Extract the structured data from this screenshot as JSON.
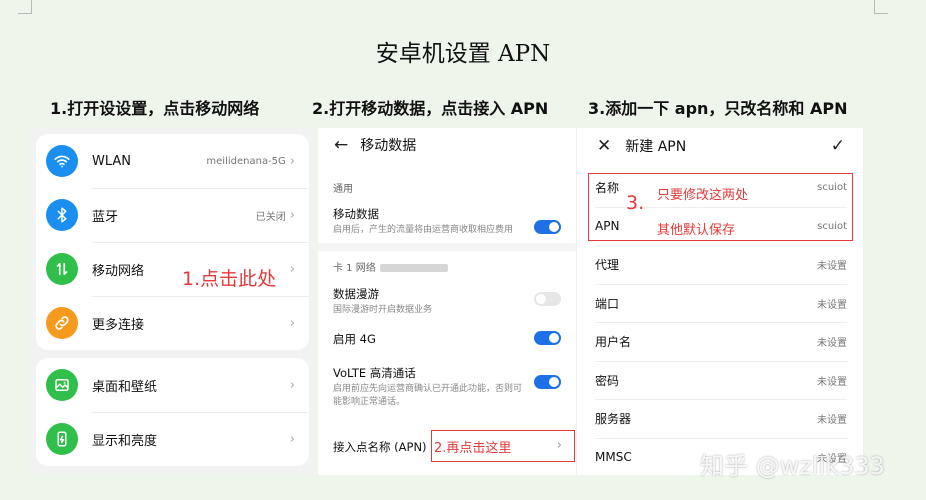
{
  "title": "安卓机设置 APN",
  "steps": [
    "1.打开设设置，点击移动网络",
    "2.打开移动数据，点击接入 APN",
    "3.添加一下 apn，只改名称和 APN"
  ],
  "settings": {
    "items": [
      {
        "label": "WLAN",
        "value": "meilidenana-5G",
        "icon": "wifi-icon",
        "color": "#1b8ff0"
      },
      {
        "label": "蓝牙",
        "value": "已关闭",
        "icon": "bluetooth-icon",
        "color": "#1b8ff0"
      },
      {
        "label": "移动网络",
        "value": "",
        "icon": "mobile-network-icon",
        "color": "#2fbf4a"
      },
      {
        "label": "更多连接",
        "value": "",
        "icon": "link-icon",
        "color": "#f59a1c"
      },
      {
        "label": "桌面和壁纸",
        "value": "",
        "icon": "wallpaper-icon",
        "color": "#2fbf4a"
      },
      {
        "label": "显示和亮度",
        "value": "",
        "icon": "display-icon",
        "color": "#2fbf4a"
      }
    ],
    "annotation": "1.点击此处"
  },
  "mobile_data": {
    "header": "移动数据",
    "section_general": "通用",
    "mobile_data_title": "移动数据",
    "mobile_data_desc": "启用后，产生的流量将由运营商收取相应费用",
    "mobile_data_on": true,
    "section_card": "卡 1 网络",
    "roaming_title": "数据漫游",
    "roaming_desc": "国际漫游时开启数据业务",
    "roaming_on": false,
    "lte_title": "启用 4G",
    "lte_on": true,
    "volte_title": "VoLTE 高清通话",
    "volte_desc": "启用前应先向运营商确认已开通此功能，否则可能影响正常通话。",
    "volte_on": true,
    "apn_title": "接入点名称 (APN)",
    "annotation": "2.再点击这里"
  },
  "new_apn": {
    "header": "新建 APN",
    "rows": [
      {
        "label": "名称",
        "value": "scuiot"
      },
      {
        "label": "APN",
        "value": "scuiot"
      },
      {
        "label": "代理",
        "value": "未设置"
      },
      {
        "label": "端口",
        "value": "未设置"
      },
      {
        "label": "用户名",
        "value": "未设置"
      },
      {
        "label": "密码",
        "value": "未设置"
      },
      {
        "label": "服务器",
        "value": "未设置"
      },
      {
        "label": "MMSC",
        "value": "未设置"
      }
    ],
    "annotation_num": "3.",
    "annotation_line1": "只要修改这两处",
    "annotation_line2": "其他默认保存"
  },
  "watermark": "知乎 @wzllk333"
}
